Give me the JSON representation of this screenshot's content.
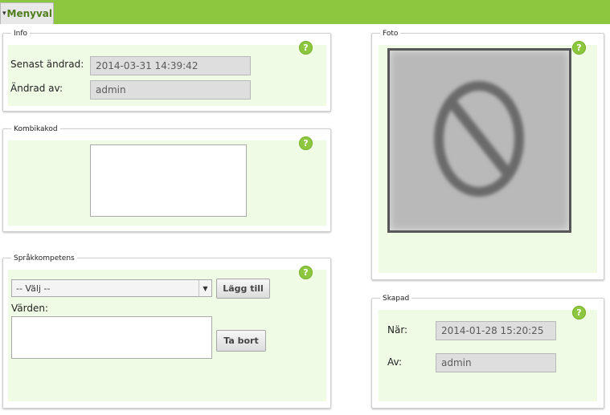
{
  "menu": {
    "label": "Menyval",
    "caret": "▾"
  },
  "info": {
    "legend": "Info",
    "help": "?",
    "senast_label": "Senast ändrad:",
    "senast_value": "2014-03-31 14:39:42",
    "andrad_av_label": "Ändrad av:",
    "andrad_av_value": "admin"
  },
  "kombikakod": {
    "legend": "Kombikakod",
    "help": "?",
    "value": ""
  },
  "sprak": {
    "legend": "Språkkompetens",
    "help": "?",
    "select_value": "-- Välj --",
    "add_button": "Lägg till",
    "values_label": "Värden:",
    "remove_button": "Ta bort"
  },
  "foto": {
    "legend": "Foto",
    "help": "?",
    "image_icon": "no-photo-icon"
  },
  "skapad": {
    "legend": "Skapad",
    "help": "?",
    "nar_label": "När:",
    "nar_value": "2014-01-28 15:20:25",
    "av_label": "Av:",
    "av_value": "admin"
  },
  "colors": {
    "accent": "#8dc63f",
    "panel_bg": "#effbe5"
  }
}
